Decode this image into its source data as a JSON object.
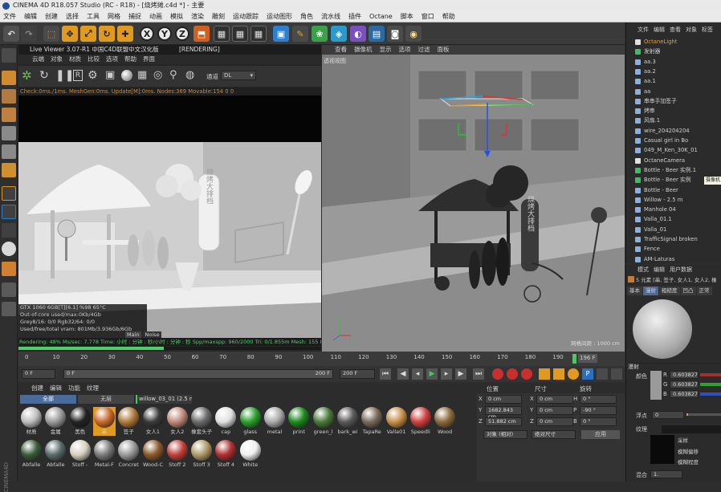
{
  "window": {
    "title": "CINEMA 4D R18.057 Studio (RC - R18) - [烧烤摊.c4d *] - 主要"
  },
  "menu": [
    "文件",
    "编辑",
    "创建",
    "选择",
    "工具",
    "网格",
    "捕捉",
    "动画",
    "模拟",
    "渲染",
    "雕刻",
    "运动跟踪",
    "运动图形",
    "角色",
    "流水线",
    "插件",
    "Octane",
    "脚本",
    "窗口",
    "帮助"
  ],
  "toolbar": {
    "xyz": [
      "X",
      "Y",
      "Z"
    ]
  },
  "live_viewer": {
    "title": "Live Viewer 3.07-R1 中国C4D联盟中文汉化版",
    "menu": [
      "云端",
      "对象",
      "材质",
      "比较",
      "选项",
      "帮助",
      "界面"
    ],
    "state": "[RENDERING]",
    "channel_label": "通道",
    "channel_value": "DL",
    "status_line": "Check:0ms./1ms. MeshGen:0ms. Update[M]:0ms. Nodes:369 Movable:154  0 0",
    "stats": [
      "GTX 1060 6GB[T][6.1]      %98      65°C",
      "Out-of-core used/max:0Kb/4Gb",
      "Grey8/16: 0/0            Rgb32/64: 0/0",
      "Used/free/total vram: 801Mb/3.936Gb/6Gb"
    ],
    "stat_tabs": [
      "Main",
      "Noise"
    ],
    "bottom": "Rendering: 48%  Ms/sec: 7.778   Time: 小时 : 分钟 : 秒/小时 : 分钟 : 秒   Spp/maxspp: 960/2000   Tri: 0/1.855m  Mesh: 155  Hair: 0",
    "sign_text": "烧烤大排档"
  },
  "viewport": {
    "menu": [
      "查看",
      "摄像机",
      "显示",
      "选项",
      "过滤",
      "面板"
    ],
    "label": "透视视图",
    "grid_text": "网格间距 : 1000 cm",
    "sign_text": "烧烤大排档"
  },
  "timeline": {
    "ticks": [
      "0",
      "10",
      "20",
      "30",
      "40",
      "50",
      "60",
      "70",
      "80",
      "90",
      "100",
      "110",
      "120",
      "130",
      "140",
      "150",
      "160",
      "170",
      "180",
      "190"
    ],
    "end_label": "196 F"
  },
  "playback": {
    "start": "0 F",
    "field": "0 F",
    "end_field": "200 F",
    "max": "200 F"
  },
  "materials": {
    "menu": [
      "创建",
      "编辑",
      "功能",
      "纹理"
    ],
    "filters": [
      "全部",
      "无层"
    ],
    "active_filter": "willow_03_01 (2.5 m)",
    "row1": [
      {
        "name": "材质",
        "color": "#bdbdbd"
      },
      {
        "name": "金属",
        "color": "#9a9a9a"
      },
      {
        "name": "黑色",
        "color": "#222"
      },
      {
        "name": "串",
        "color": "#c86a2a"
      },
      {
        "name": "签子",
        "color": "#b07a3a"
      },
      {
        "name": "女人1",
        "color": "#3a3a3a"
      },
      {
        "name": "女人2",
        "color": "#c08a7a"
      },
      {
        "name": "橡套头子",
        "color": "#6a6a6a"
      },
      {
        "name": "cap",
        "color": "#e0e0e0"
      },
      {
        "name": "glass",
        "color": "#2aa02a"
      },
      {
        "name": "metal",
        "color": "#aaaaaa"
      },
      {
        "name": "print",
        "color": "#1e8a1e"
      },
      {
        "name": "green_l",
        "color": "#4a7a3a"
      },
      {
        "name": "bark_wi",
        "color": "#5a5a5a"
      },
      {
        "name": "TapaRe",
        "color": "#7a6a5a"
      },
      {
        "name": "Valla01",
        "color": "#c8904a"
      },
      {
        "name": "Speedli",
        "color": "#d04040"
      },
      {
        "name": "Wood",
        "color": "#8a6a3a"
      }
    ],
    "row2": [
      {
        "name": "Abfalle",
        "color": "#3a5a3a"
      },
      {
        "name": "Abfalle",
        "color": "#5a6a6a"
      },
      {
        "name": "Stoff -",
        "color": "#d8d0c0"
      },
      {
        "name": "Metal-F",
        "color": "#7a7a7a"
      },
      {
        "name": "Concret",
        "color": "#9a9a9a"
      },
      {
        "name": "Wood-C",
        "color": "#8a5a2a"
      },
      {
        "name": "Stoff 2",
        "color": "#c0403a"
      },
      {
        "name": "Stoff 3",
        "color": "#b09a6a"
      },
      {
        "name": "Stoff 4",
        "color": "#b03030"
      },
      {
        "name": "White",
        "color": "#f0f0f0"
      }
    ]
  },
  "coords": {
    "headers": [
      "位置",
      "尺寸",
      "旋转"
    ],
    "rows": [
      [
        "X",
        "0 cm",
        "X",
        "0 cm",
        "H",
        "0 °"
      ],
      [
        "Y",
        "1682.843 cm",
        "Y",
        "0 cm",
        "P",
        "-90 °"
      ],
      [
        "Z",
        "51.882 cm",
        "Z",
        "0 cm",
        "B",
        "0 °"
      ]
    ],
    "mode": "对象 (相对)",
    "size_mode": "绝对尺寸",
    "apply": "应用"
  },
  "objects": {
    "menu": [
      "文件",
      "编辑",
      "查看",
      "对象",
      "标签"
    ],
    "items": [
      "OctaneLight",
      "发射器",
      "aa.3",
      "aa.2",
      "aa.1",
      "aa",
      "串串手加签子",
      "烤串",
      "风扇.1",
      "wire_204204204",
      "Casual girl in Bo",
      "049_M_Ken_30K_01",
      "OctaneCamera",
      "Bottle - Beer 实例.1",
      "Bottle - Beer 实例",
      "Bottle - Beer",
      "Willow - 2.5 m",
      "Manhole 04",
      "Valla_01.1",
      "Valla_01",
      "TrafficSignal broken",
      "Fence",
      "AM-Laturas"
    ],
    "tooltip": "摄像机"
  },
  "attributes": {
    "menu": [
      "模式",
      "编辑",
      "用户数据"
    ],
    "summary": "5 元素 [串, 签子, 女人1, 女人2, 橡",
    "tabs": [
      "基本",
      "漫射",
      "粗糙度",
      "凹凸",
      "正常"
    ],
    "section": "漫射",
    "color_label": "颜色",
    "rgb": [
      {
        "ch": "R",
        "v": "0.603827"
      },
      {
        "ch": "G",
        "v": "0.603827"
      },
      {
        "ch": "B",
        "v": "0.603827"
      }
    ],
    "float_label": "浮点",
    "float_value": "0",
    "texture_label": "纹理",
    "sample_label": "采样",
    "mode1": "模糊偏移",
    "mode2": "模糊程度",
    "mix_label": "混合",
    "mix_value": "1."
  }
}
